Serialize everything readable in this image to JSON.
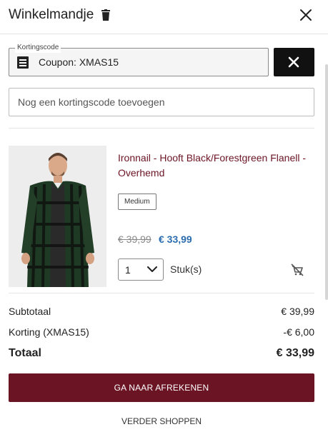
{
  "header": {
    "title": "Winkelmandje"
  },
  "coupon": {
    "legend": "Kortingscode",
    "value": "Coupon: XMAS15"
  },
  "code_input": {
    "placeholder": "Nog een kortingscode toevoegen"
  },
  "product": {
    "name": "Ironnail - Hooft Black/Forestgreen Flanell - Overhemd",
    "size": "Medium",
    "old_price": "€ 39,99",
    "new_price": "€ 33,99",
    "quantity": "1",
    "unit": "Stuk(s)"
  },
  "summary": {
    "subtotal_label": "Subtotaal",
    "subtotal_value": "€ 39,99",
    "discount_label": "Korting (XMAS15)",
    "discount_value": "-€ 6,00",
    "total_label": "Totaal",
    "total_value": "€ 33,99"
  },
  "actions": {
    "checkout_label": "GA NAAR AFREKENEN",
    "continue_label": "VERDER SHOPPEN"
  },
  "colors": {
    "brand": "#6b1424",
    "price_accent": "#2a6cae",
    "dark_button": "#111111"
  }
}
